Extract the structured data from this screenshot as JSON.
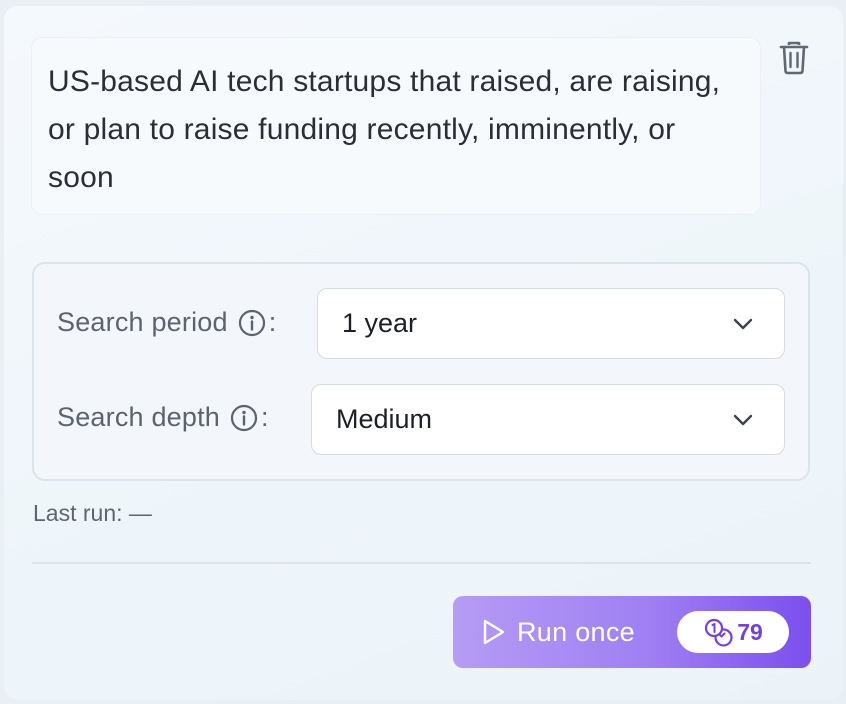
{
  "query": {
    "text": "US-based AI tech startups that raised, are raising, or plan to raise funding recently, imminently, or soon"
  },
  "actions": {
    "delete_icon": "trash-icon"
  },
  "settings": {
    "search_period": {
      "label": "Search period",
      "colon": ":",
      "value": "1 year"
    },
    "search_depth": {
      "label": "Search depth",
      "colon": ":",
      "value": "Medium"
    }
  },
  "status": {
    "last_run": "Last run: —"
  },
  "run_button": {
    "label": "Run once",
    "credits": "79"
  },
  "colors": {
    "accent": "#7b4fee",
    "accent_light": "#b59cf4",
    "text": "#2a2e36",
    "muted": "#5c636e"
  }
}
